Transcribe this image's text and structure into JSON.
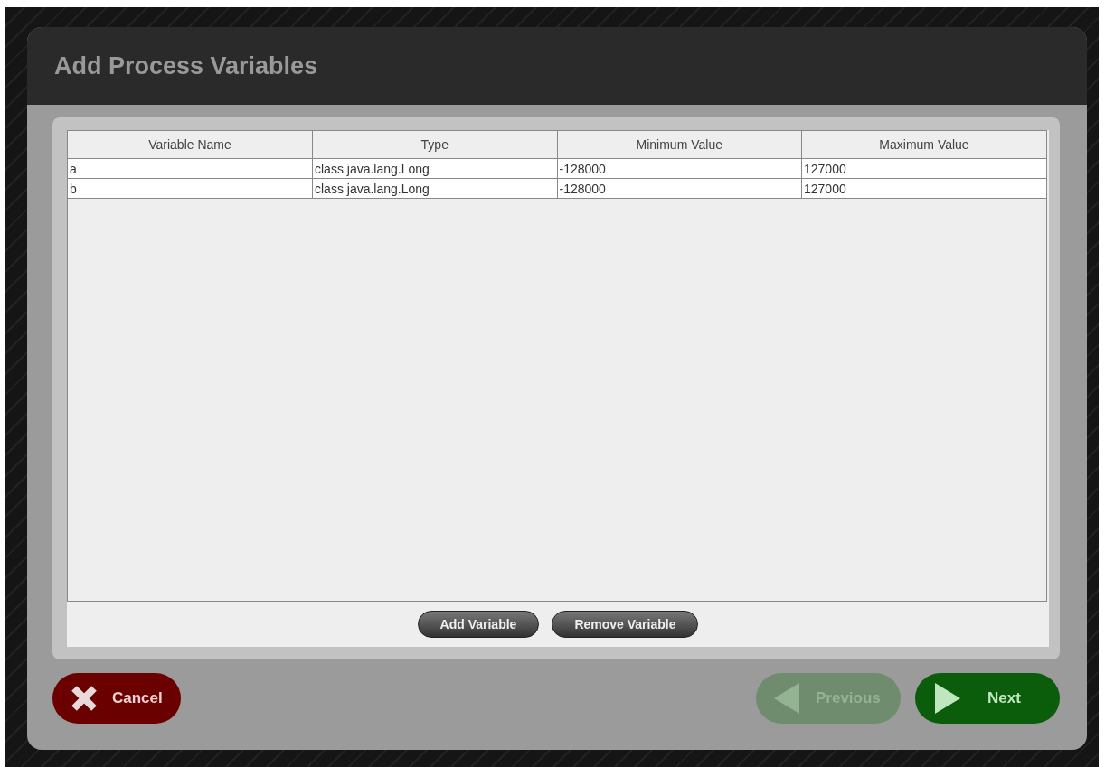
{
  "dialog": {
    "title": "Add Process Variables"
  },
  "table": {
    "columns": [
      "Variable Name",
      "Type",
      "Minimum Value",
      "Maximum Value"
    ],
    "rows": [
      [
        "a",
        "class java.lang.Long",
        "-128000",
        "127000"
      ],
      [
        "b",
        "class java.lang.Long",
        "-128000",
        "127000"
      ]
    ]
  },
  "table_buttons": [
    "Add Variable",
    "Remove Variable"
  ],
  "footer": {
    "cancel": {
      "label": "Cancel"
    },
    "nav": [
      {
        "kind": "previous",
        "label": "Previous",
        "disabled": true
      },
      {
        "kind": "next",
        "label": "Next",
        "disabled": false
      }
    ]
  }
}
